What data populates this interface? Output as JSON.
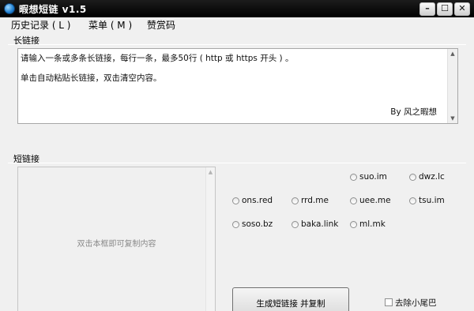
{
  "window": {
    "title": "暇想短链 v1.5",
    "controls": {
      "minimize": "–",
      "maximize": "☐",
      "close": "✕"
    }
  },
  "menu": [
    "历史记录 ( L )",
    "菜单 ( M )",
    "赞赏码"
  ],
  "long_link": {
    "label": "长链接",
    "lines": [
      "请输入一条或多条长链接，每行一条，最多50行 ( http 或 https 开头 ) 。",
      "单击自动粘贴长链接，双击清空内容。"
    ],
    "author": "By 风之暇想"
  },
  "short_link": {
    "label": "短链接",
    "output_hint": "双击本框即可复制内容"
  },
  "services": [
    "suo.im",
    "dwz.lc",
    "ons.red",
    "rrd.me",
    "uee.me",
    "tsu.im",
    "soso.bz",
    "baka.link",
    "ml.mk"
  ],
  "generate_button": "生成短链接 并复制",
  "remove_tail": {
    "label": "去除小尾巴",
    "checked": false
  },
  "icons": {
    "scroll_up": "up-arrow-icon",
    "scroll_down": "down-arrow-icon",
    "app": "app-icon"
  }
}
